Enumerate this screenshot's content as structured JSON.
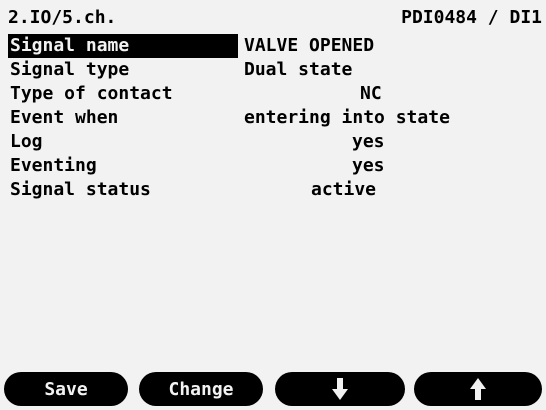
{
  "header": {
    "path": "2.IO/5.ch.",
    "device": "PDI0484 / DI1"
  },
  "rows": [
    {
      "label": "Signal name",
      "value": "VALVE OPENED",
      "selected": true
    },
    {
      "label": "Signal type",
      "value": "Dual state"
    },
    {
      "label": "Type of contact",
      "value": "NC"
    },
    {
      "label": "Event when",
      "value": "entering into state"
    },
    {
      "label": "Log",
      "value": "yes"
    },
    {
      "label": "Eventing",
      "value": "yes"
    },
    {
      "label": "Signal status",
      "value": "active"
    }
  ],
  "softkeys": [
    {
      "label": "Save"
    },
    {
      "label": "Change"
    },
    {
      "icon": "arrow-down-icon"
    },
    {
      "icon": "arrow-up-icon"
    }
  ]
}
